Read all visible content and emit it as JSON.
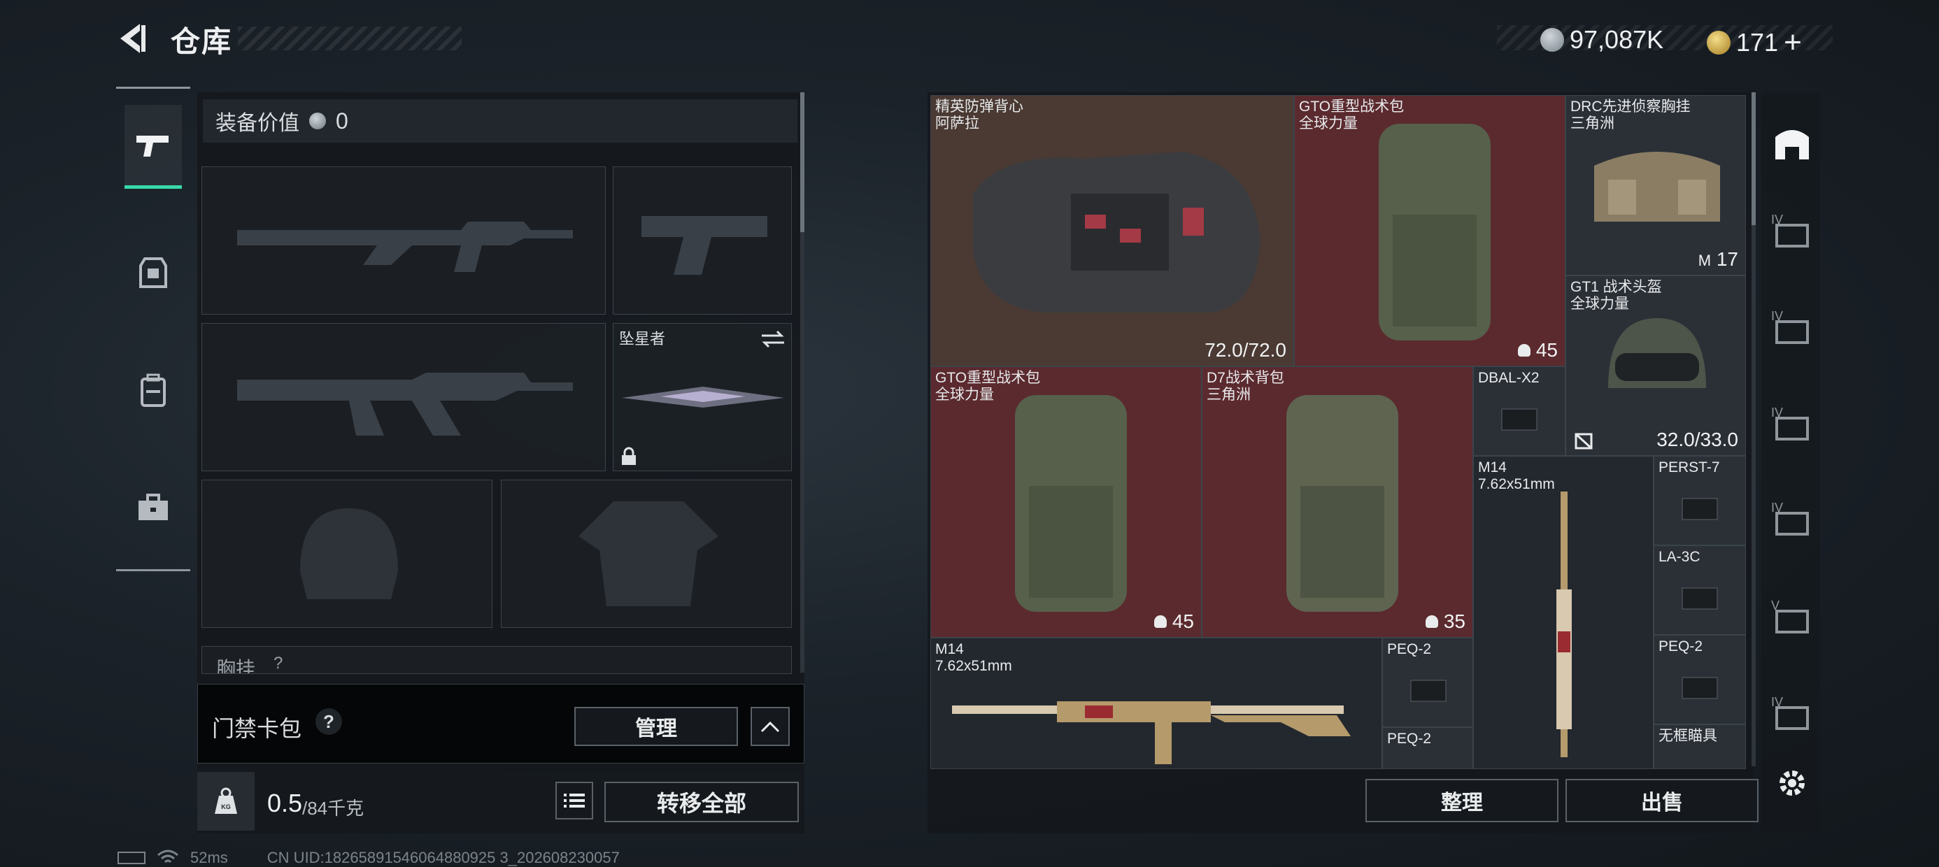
{
  "header": {
    "title": "仓库",
    "currency_primary": "97,087K",
    "currency_secondary": "171",
    "add_symbol": "+"
  },
  "loadout": {
    "equipment_value_label": "装备价值",
    "equipment_value": "0",
    "melee_name": "坠星者",
    "chest_rig_label": "胸挂",
    "chest_rig_help": "?",
    "keycard_label": "门禁卡包",
    "keycard_help": "?",
    "manage_button": "管理",
    "weight_current": "0.5",
    "weight_max": "/84千克",
    "weight_badge": "KG",
    "transfer_all_button": "转移全部"
  },
  "stash_items": [
    {
      "name": "精英防弹背心",
      "sub": "阿萨拉",
      "value": "72.0/72.0"
    },
    {
      "name": "GTO重型战术包",
      "sub": "全球力量",
      "value": "45"
    },
    {
      "name": "DRC先进侦察胸挂",
      "sub": "三角洲",
      "value": "17"
    },
    {
      "name": "GT1 战术头盔",
      "sub": "全球力量",
      "value": "32.0/33.0"
    },
    {
      "name": "GTO重型战术包",
      "sub": "全球力量",
      "value": "45"
    },
    {
      "name": "D7战术背包",
      "sub": "三角洲",
      "value": "35"
    },
    {
      "name": "DBAL-X2",
      "sub": "",
      "value": ""
    },
    {
      "name": "M14",
      "sub": "7.62x51mm",
      "value": ""
    },
    {
      "name": "PERST-7",
      "sub": "",
      "value": ""
    },
    {
      "name": "LA-3C",
      "sub": "",
      "value": ""
    },
    {
      "name": "M14",
      "sub": "7.62x51mm",
      "value": ""
    },
    {
      "name": "PEQ-2",
      "sub": "",
      "value": ""
    },
    {
      "name": "PEQ-2",
      "sub": "",
      "value": ""
    },
    {
      "name": "PEQ-2",
      "sub": "",
      "value": ""
    },
    {
      "name": "无框瞄具",
      "sub": "",
      "value": ""
    }
  ],
  "stash_actions": {
    "sort_button": "整理",
    "sell_button": "出售"
  },
  "side_tabs": [
    "IV",
    "IV",
    "IV",
    "IV",
    "V",
    "IV"
  ],
  "status_bar": {
    "ping": "52ms",
    "uid": "CN UID:18265891546064880925 3_202608230057"
  },
  "colors": {
    "accent_green": "#38d9a9",
    "red_cell": "#5b2a2e",
    "brown_cell": "#4a3a33",
    "dark_cell": "#1c2126"
  }
}
